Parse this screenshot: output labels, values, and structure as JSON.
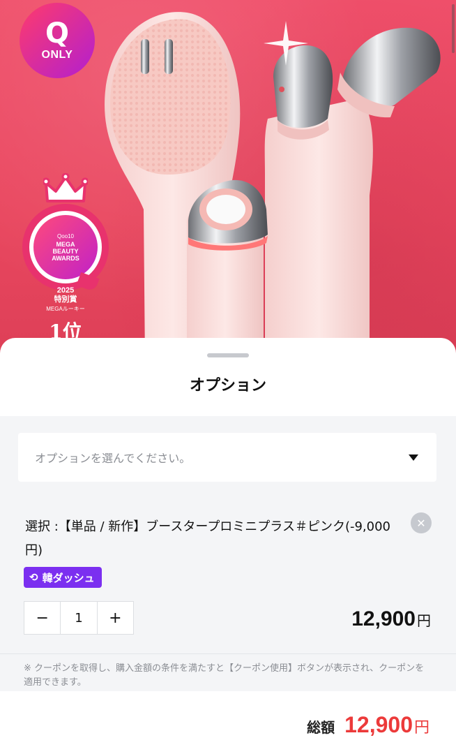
{
  "hero": {
    "badge_letter": "Q",
    "badge_text": "ONLY",
    "award": {
      "brand": "Qoo10",
      "line1": "MEGA",
      "line2": "BEAUTY",
      "line3": "AWARDS",
      "year": "2025",
      "special": "特別賞",
      "category": "MEGAルーキー",
      "rank": "1位"
    },
    "colors": {
      "background": "#e9475f",
      "badge_gradient_start": "#ff3b6b",
      "badge_gradient_end": "#b21fd0"
    }
  },
  "sheet": {
    "title": "オプション",
    "dropdown": {
      "placeholder": "オプションを選んでください。",
      "icon": "caret-down-icon"
    },
    "selected_option": {
      "name": "選択 :【単品 / 新作】ブースタープロミニプラス＃ピンク(-9,000円)",
      "remove_icon": "close-icon",
      "badge": {
        "icon": "dash-icon",
        "label": "韓ダッシュ",
        "color": "#7b2ff0"
      },
      "quantity": "1",
      "minus_label": "−",
      "plus_label": "+",
      "price": "12,900",
      "currency": "円"
    },
    "notice": "※ クーポンを取得し、購入金額の条件を満たすと【クーポン使用】ボタンが表示され、クーポンを適用できます。",
    "total": {
      "label": "総額",
      "amount": "12,900",
      "currency": "円",
      "color": "#ec3a3a"
    }
  }
}
